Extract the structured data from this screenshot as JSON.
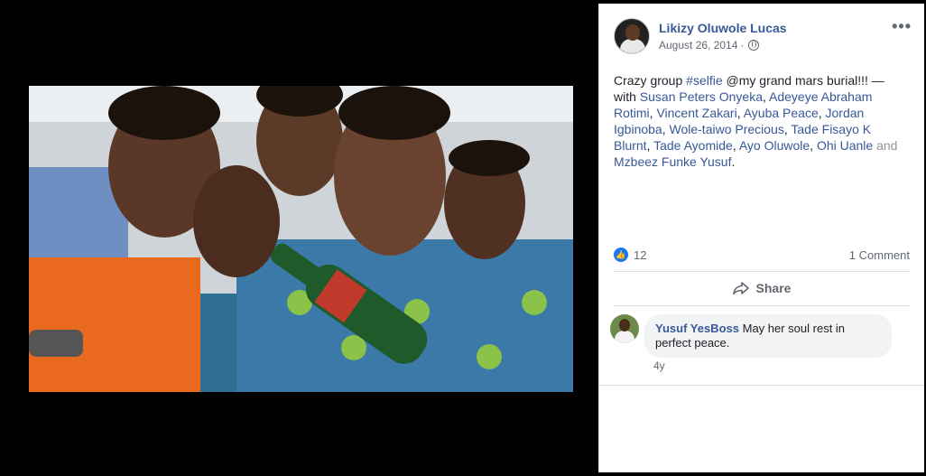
{
  "post": {
    "author": "Likizy Oluwole Lucas",
    "date": "August 26, 2014",
    "separator": "·",
    "more": "•••",
    "text_prefix": "Crazy group ",
    "hashtag": "#selfie",
    "text_mid": " @my grand mars burial!!! — with ",
    "tagged": [
      "Susan Peters Onyeka",
      "Adeyeye Abraham Rotimi",
      "Vincent Zakari",
      "Ayuba Peace",
      "Jordan Igbinoba",
      "Wole-taiwo Precious",
      "Tade Fisayo K Blurnt",
      "Tade Ayomide",
      "Ayo Oluwole",
      "Ohi Uanle",
      "Mzbeez Funke Yusuf"
    ],
    "and_word": " and ",
    "end_punct": "."
  },
  "reactions": {
    "like_count": "12",
    "comments_label": "1 Comment"
  },
  "actions": {
    "share_label": "Share"
  },
  "comment": {
    "author": "Yusuf YesBoss",
    "text": "May her soul rest in perfect peace.",
    "time": "4y"
  },
  "colors": {
    "link": "#385898",
    "like": "#1877f2",
    "viewer_bg": "#000000"
  }
}
